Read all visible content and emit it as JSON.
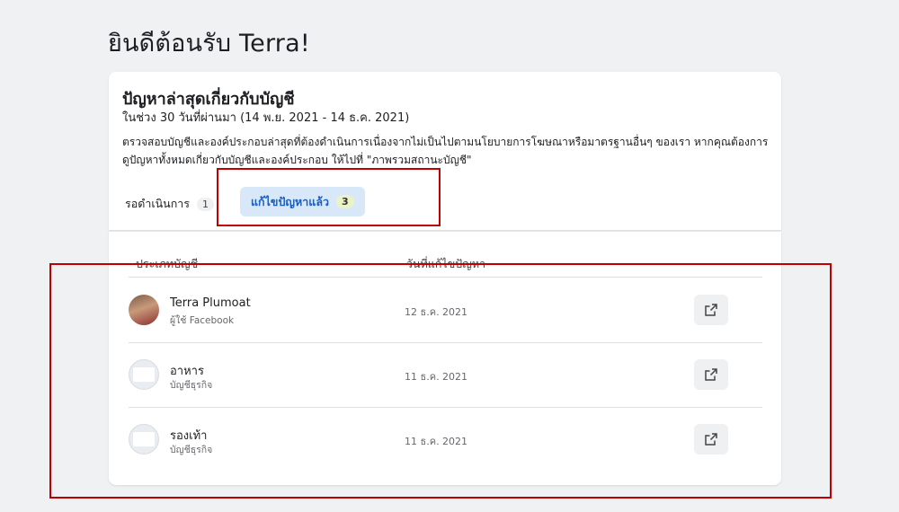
{
  "page": {
    "title": "ยินดีต้อนรับ Terra!"
  },
  "card": {
    "title": "ปัญหาล่าสุดเกี่ยวกับบัญชี",
    "subtitle": "ในช่วง 30 วันที่ผ่านมา (14 พ.ย. 2021 - 14 ธ.ค. 2021)",
    "description": "ตรวจสอบบัญชีและองค์ประกอบล่าสุดที่ต้องดำเนินการเนื่องจากไม่เป็นไปตามนโยบายการโฆษณาหรือมาตรฐานอื่นๆ ของเรา หากคุณต้องการดูปัญหาทั้งหมดเกี่ยวกับบัญชีและองค์ประกอบ ให้ไปที่ \"ภาพรวมสถานะบัญชี\"",
    "tabs": {
      "pending": {
        "label": "รอดำเนินการ",
        "count": "1"
      },
      "resolved": {
        "label": "แก้ไขปัญหาแล้ว",
        "count": "3"
      }
    }
  },
  "table": {
    "columns": {
      "type": "ประเภทบัญชี",
      "date": "วันที่แก้ไขปัญหา"
    },
    "rows": [
      {
        "name": "Terra Plumoat",
        "subtitle": "ผู้ใช้ Facebook",
        "date": "12 ธ.ค. 2021",
        "avatar": "photo"
      },
      {
        "name": "อาหาร",
        "subtitle": "บัญชีธุรกิจ",
        "date": "11 ธ.ค. 2021",
        "avatar": "blank"
      },
      {
        "name": "รองเท้า",
        "subtitle": "บัญชีธุรกิจ",
        "date": "11 ธ.ค. 2021",
        "avatar": "blank"
      }
    ],
    "action_icon": "external-link-icon"
  },
  "colors": {
    "annotation": "#c00000",
    "tab_active_bg": "#d9e8f8",
    "tab_active_text": "#1d5fb8"
  }
}
